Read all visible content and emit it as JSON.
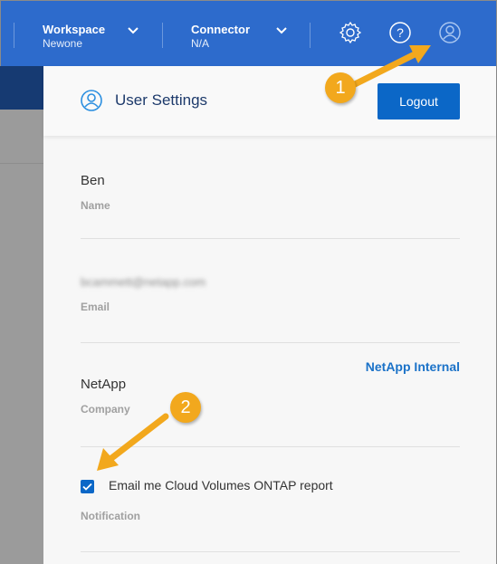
{
  "topbar": {
    "workspace": {
      "title": "Workspace",
      "value": "Newone"
    },
    "connector": {
      "title": "Connector",
      "value": "N/A"
    },
    "icons": [
      "settings-icon",
      "help-icon",
      "user-icon"
    ]
  },
  "panel": {
    "title": "User Settings",
    "logout_label": "Logout",
    "fields": [
      {
        "value": "Ben",
        "label": "Name"
      },
      {
        "value": "bcammett@netapp.com",
        "label": "Email",
        "blurred": true
      },
      {
        "value": "NetApp",
        "label": "Company"
      }
    ],
    "company_link": "NetApp Internal",
    "notification": {
      "checkbox_label": "Email me Cloud Volumes ONTAP report",
      "checked": true,
      "label": "Notification"
    }
  },
  "annotations": {
    "step1": "1",
    "step2": "2"
  },
  "colors": {
    "topbar": "#2d6bcc",
    "primary": "#0b67c7",
    "callout": "#f2a81d"
  }
}
